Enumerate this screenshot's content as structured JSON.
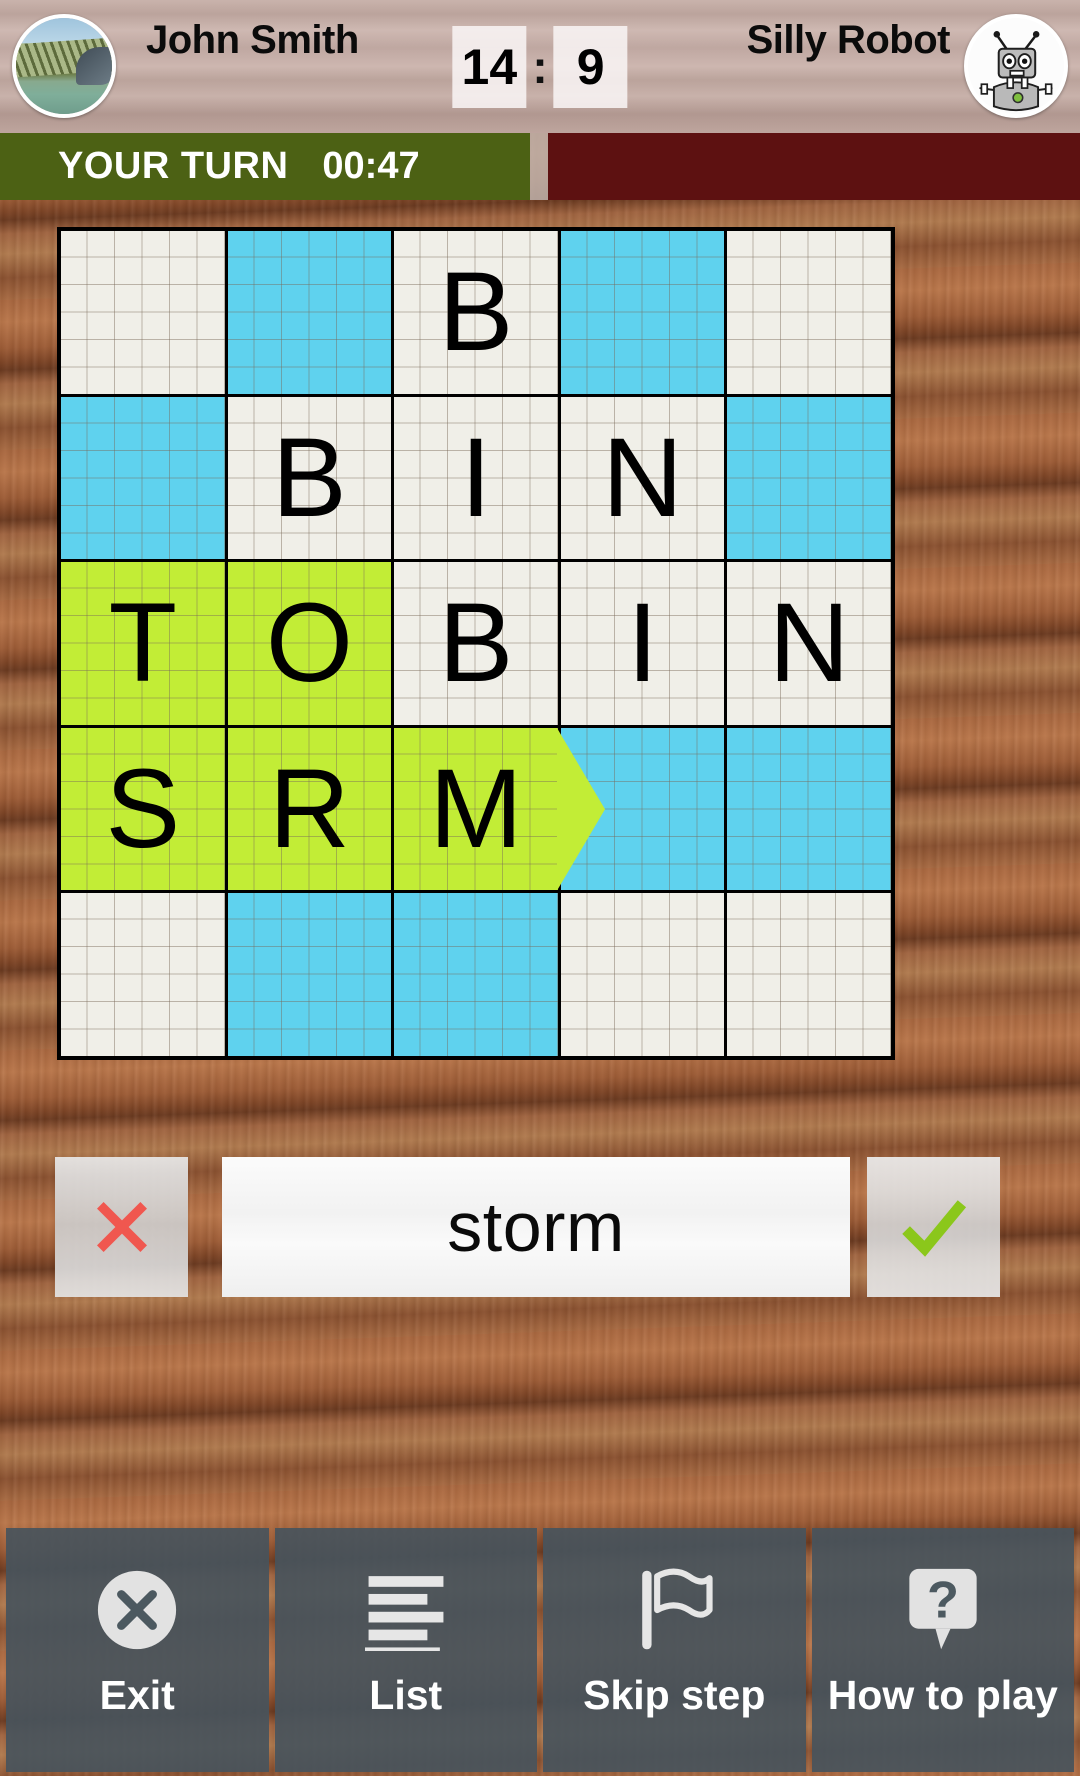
{
  "header": {
    "player_left": "John Smith",
    "player_right": "Silly Robot",
    "score_left": "14",
    "score_colon": ":",
    "score_right": "9",
    "avatar_left_icon": "photo-avatar",
    "avatar_right_icon": "robot-avatar"
  },
  "turn": {
    "label": "YOUR TURN",
    "time": "00:47",
    "active_color": "#4c6114",
    "inactive_color": "#5d1111"
  },
  "board": {
    "rows": 5,
    "cols": 5,
    "colors": {
      "blue": "#5fd2ee",
      "green": "#c2ed36",
      "empty": "#f0efe8"
    },
    "cells": [
      [
        {
          "letter": "",
          "state": "empty"
        },
        {
          "letter": "",
          "state": "blue"
        },
        {
          "letter": "B",
          "state": "empty"
        },
        {
          "letter": "",
          "state": "blue"
        },
        {
          "letter": "",
          "state": "empty"
        }
      ],
      [
        {
          "letter": "",
          "state": "blue"
        },
        {
          "letter": "B",
          "state": "empty"
        },
        {
          "letter": "I",
          "state": "empty"
        },
        {
          "letter": "N",
          "state": "empty"
        },
        {
          "letter": "",
          "state": "blue"
        }
      ],
      [
        {
          "letter": "T",
          "state": "green"
        },
        {
          "letter": "O",
          "state": "green"
        },
        {
          "letter": "B",
          "state": "empty"
        },
        {
          "letter": "I",
          "state": "empty"
        },
        {
          "letter": "N",
          "state": "empty"
        }
      ],
      [
        {
          "letter": "S",
          "state": "green"
        },
        {
          "letter": "R",
          "state": "green"
        },
        {
          "letter": "M",
          "state": "green",
          "arrow": "right-arrowhead"
        },
        {
          "letter": "",
          "state": "blue"
        },
        {
          "letter": "",
          "state": "blue"
        }
      ],
      [
        {
          "letter": "",
          "state": "empty"
        },
        {
          "letter": "",
          "state": "blue"
        },
        {
          "letter": "",
          "state": "blue"
        },
        {
          "letter": "",
          "state": "empty"
        },
        {
          "letter": "",
          "state": "empty"
        }
      ]
    ]
  },
  "input": {
    "word": "storm",
    "cancel_icon": "x-icon",
    "confirm_icon": "check-icon",
    "cancel_color": "#f0574f",
    "confirm_color": "#8bc71b"
  },
  "toolbar": {
    "items": [
      {
        "label": "Exit",
        "icon": "circle-x-icon"
      },
      {
        "label": "List",
        "icon": "list-lines-icon"
      },
      {
        "label": "Skip\nstep",
        "icon": "flag-icon"
      },
      {
        "label": "How to\nplay",
        "icon": "question-bubble-icon"
      }
    ]
  }
}
